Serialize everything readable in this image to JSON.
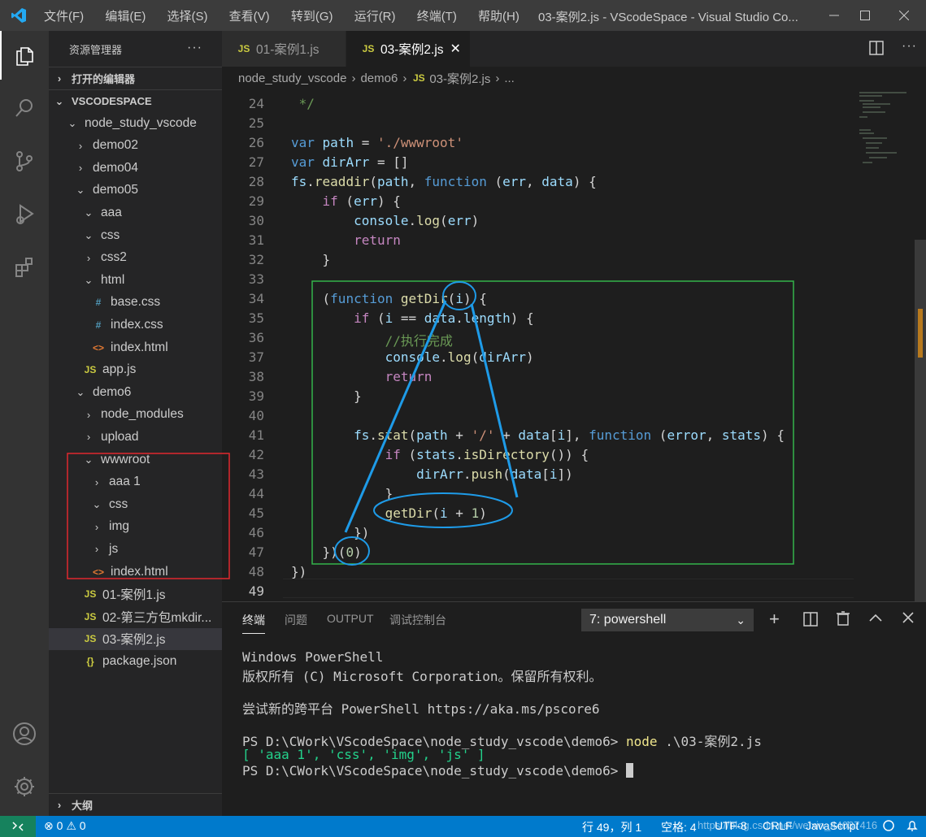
{
  "window": {
    "menu": [
      "文件(F)",
      "编辑(E)",
      "选择(S)",
      "查看(V)",
      "转到(G)",
      "运行(R)",
      "终端(T)",
      "帮助(H)"
    ],
    "title": "03-案例2.js - VScodeSpace - Visual Studio Co..."
  },
  "sidebar": {
    "header": "资源管理器",
    "more": "···",
    "open_editors": "打开的编辑器",
    "workspace": "VSCODESPACE",
    "outline": "大纲",
    "tree": [
      {
        "label": "node_study_vscode",
        "type": "folder-open",
        "indent": 0
      },
      {
        "label": "demo02",
        "type": "folder",
        "indent": 1
      },
      {
        "label": "demo04",
        "type": "folder",
        "indent": 1
      },
      {
        "label": "demo05",
        "type": "folder-open",
        "indent": 1
      },
      {
        "label": "aaa",
        "type": "folder-open",
        "indent": 2
      },
      {
        "label": "css",
        "type": "folder-open",
        "indent": 2
      },
      {
        "label": "css2",
        "type": "folder",
        "indent": 2
      },
      {
        "label": "html",
        "type": "folder-open",
        "indent": 2
      },
      {
        "label": "base.css",
        "type": "css",
        "indent": 3
      },
      {
        "label": "index.css",
        "type": "css",
        "indent": 3
      },
      {
        "label": "index.html",
        "type": "html",
        "indent": 3
      },
      {
        "label": "app.js",
        "type": "js",
        "indent": 2
      },
      {
        "label": "demo6",
        "type": "folder-open",
        "indent": 1
      },
      {
        "label": "node_modules",
        "type": "folder",
        "indent": 2
      },
      {
        "label": "upload",
        "type": "folder",
        "indent": 2
      },
      {
        "label": "wwwroot",
        "type": "folder-open",
        "indent": 2
      },
      {
        "label": "aaa 1",
        "type": "folder",
        "indent": 3
      },
      {
        "label": "css",
        "type": "folder-open",
        "indent": 3
      },
      {
        "label": "img",
        "type": "folder",
        "indent": 3
      },
      {
        "label": "js",
        "type": "folder",
        "indent": 3
      },
      {
        "label": "index.html",
        "type": "html",
        "indent": 3
      },
      {
        "label": "01-案例1.js",
        "type": "js",
        "indent": 2
      },
      {
        "label": "02-第三方包mkdir...",
        "type": "js",
        "indent": 2
      },
      {
        "label": "03-案例2.js",
        "type": "js",
        "indent": 2,
        "selected": true
      },
      {
        "label": "package.json",
        "type": "json",
        "indent": 2
      }
    ]
  },
  "tabs": [
    {
      "label": "01-案例1.js",
      "active": false
    },
    {
      "label": "03-案例2.js",
      "active": true
    }
  ],
  "breadcrumb": {
    "parts": [
      "node_study_vscode",
      "demo6",
      "03-案例2.js",
      "..."
    ]
  },
  "editor": {
    "line_numbers": [
      "24",
      "25",
      "26",
      "27",
      "28",
      "29",
      "30",
      "31",
      "32",
      "33",
      "34",
      "35",
      "36",
      "37",
      "38",
      "39",
      "40",
      "41",
      "42",
      "43",
      "44",
      "45",
      "46",
      "47",
      "48",
      "49"
    ]
  },
  "panel": {
    "tabs": [
      "终端",
      "问题",
      "OUTPUT",
      "调试控制台"
    ],
    "terminal_select": "7: powershell",
    "terminal_lines": [
      "Windows PowerShell",
      "版权所有 (C) Microsoft Corporation。保留所有权利。",
      "",
      "尝试新的跨平台 PowerShell https://aka.ms/pscore6",
      "",
      "PS D:\\CWork\\VScodeSpace\\node_study_vscode\\demo6> ",
      "[ 'aaa 1', 'css', 'img', 'js' ]",
      "PS D:\\CWork\\VScodeSpace\\node_study_vscode\\demo6> "
    ],
    "cmd": "node",
    "cmd_arg": ".\\03-案例2.js"
  },
  "statusbar": {
    "errors": "0",
    "warnings": "0",
    "position": "行 49，列 1",
    "spaces": "空格: 4",
    "encoding": "UTF-8",
    "eol": "CRLF",
    "language": "JavaScript",
    "watermark": "https://blog.csdn.net/weixin_44037416"
  },
  "colors": {
    "accent": "#007acc",
    "annot_blue": "#1e9be8",
    "annot_red": "#e0282e",
    "annot_green": "#34b34a"
  }
}
